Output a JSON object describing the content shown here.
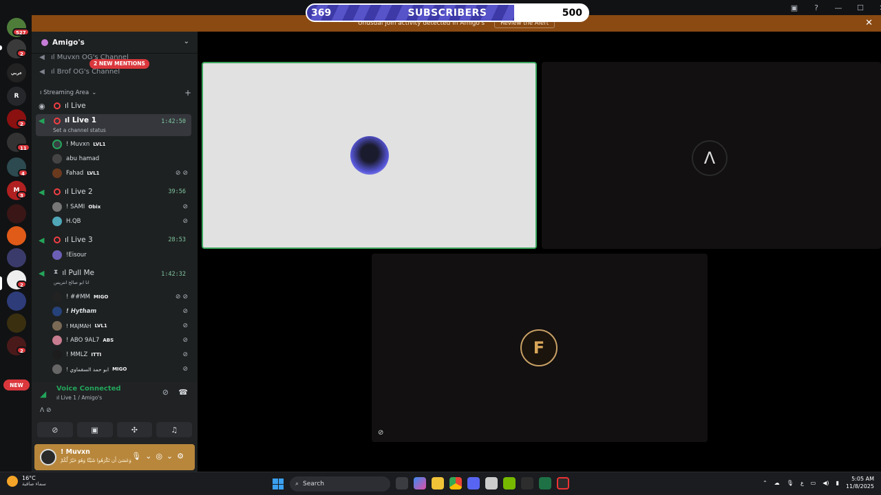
{
  "window": {
    "controls": [
      "▣",
      "?",
      "—",
      "☐",
      "✕"
    ]
  },
  "subscribers": {
    "current": "369",
    "label": "SUBSCRIBERS",
    "goal": "500",
    "progress": 0.738
  },
  "alert": {
    "text": "Unusual join activity detected in Amigo's",
    "button": "Review the Alert",
    "close": "✕"
  },
  "rail": {
    "home_badge": "527",
    "badges": [
      "2",
      "2",
      "11",
      "4",
      "3",
      "2",
      "2"
    ],
    "new_label": "NEW"
  },
  "guild": {
    "name": "Amigo's"
  },
  "channels_top": [
    {
      "label": "ıl Muvxn OG's Channel"
    },
    {
      "label": "ıl Brof OG's Channel"
    }
  ],
  "mentions_pill": "2 NEW MENTIONS",
  "category": {
    "label": "ı Streaming Area",
    "add": "+"
  },
  "voice_channels": {
    "live": {
      "label": "ıl Live"
    },
    "live1": {
      "label": "ıl Live 1",
      "time": "1:42:50",
      "status": "Set a channel status",
      "users": [
        {
          "name": "! Muvxn",
          "tag": "LVL1",
          "color": "#3a3f44"
        },
        {
          "name": "abu hamad",
          "tag": "",
          "color": "#444"
        },
        {
          "name": "Fahad",
          "tag": "LVL1",
          "color": "#6b3a1e"
        }
      ]
    },
    "live2": {
      "label": "ıl Live 2",
      "time": "39:56",
      "users": [
        {
          "name": "! SAMI",
          "tag": "Obix",
          "color": "#777"
        },
        {
          "name": "H.QB",
          "tag": "",
          "color": "#4fa7b8"
        }
      ]
    },
    "live3": {
      "label": "ıl Live 3",
      "time": "28:53",
      "users": [
        {
          "name": "!Eisour",
          "tag": "",
          "color": "#6b5fb5"
        }
      ]
    },
    "pullme": {
      "label": "ıl Pull Me",
      "time": "1:42:32",
      "status": "انا ابو صالح انتريس",
      "users": [
        {
          "name": "! ##MM",
          "tag": "MIGO",
          "color": "#222"
        },
        {
          "name": "! Hytham",
          "tag": "",
          "color": "#26427a"
        },
        {
          "name": "! MAJMAH",
          "tag": "LVL1",
          "color": "#7a6a55"
        },
        {
          "name": "! ABO 9AL7",
          "tag": "ABS",
          "color": "#c77d8f"
        },
        {
          "name": "! MMLZ",
          "tag": "ITTI",
          "color": "#1d1d1d"
        },
        {
          "name": "! ابو حمد السقماوي",
          "tag": "MIGO",
          "color": "#666"
        }
      ]
    }
  },
  "voice_panel": {
    "status": "Voice Connected",
    "location": "ıl Live 1 / Amigo's"
  },
  "user_panel": {
    "name": "! Muvxn",
    "status": "وَعَسَىٰ أَن تَكْرَهُوا شَيْئًا وَهُوَ خَيْرٌ لَّكُمْ"
  },
  "taskbar": {
    "temp": "16°C",
    "weather": "سماء صافية",
    "search": "Search",
    "lang": "ع",
    "time": "5:05 AM",
    "date": "11/8/2025"
  },
  "colors": {
    "accent_green": "#23a55a",
    "alert_orange": "#8a4a12",
    "user_panel": "#b8873c",
    "danger": "#da373c"
  }
}
